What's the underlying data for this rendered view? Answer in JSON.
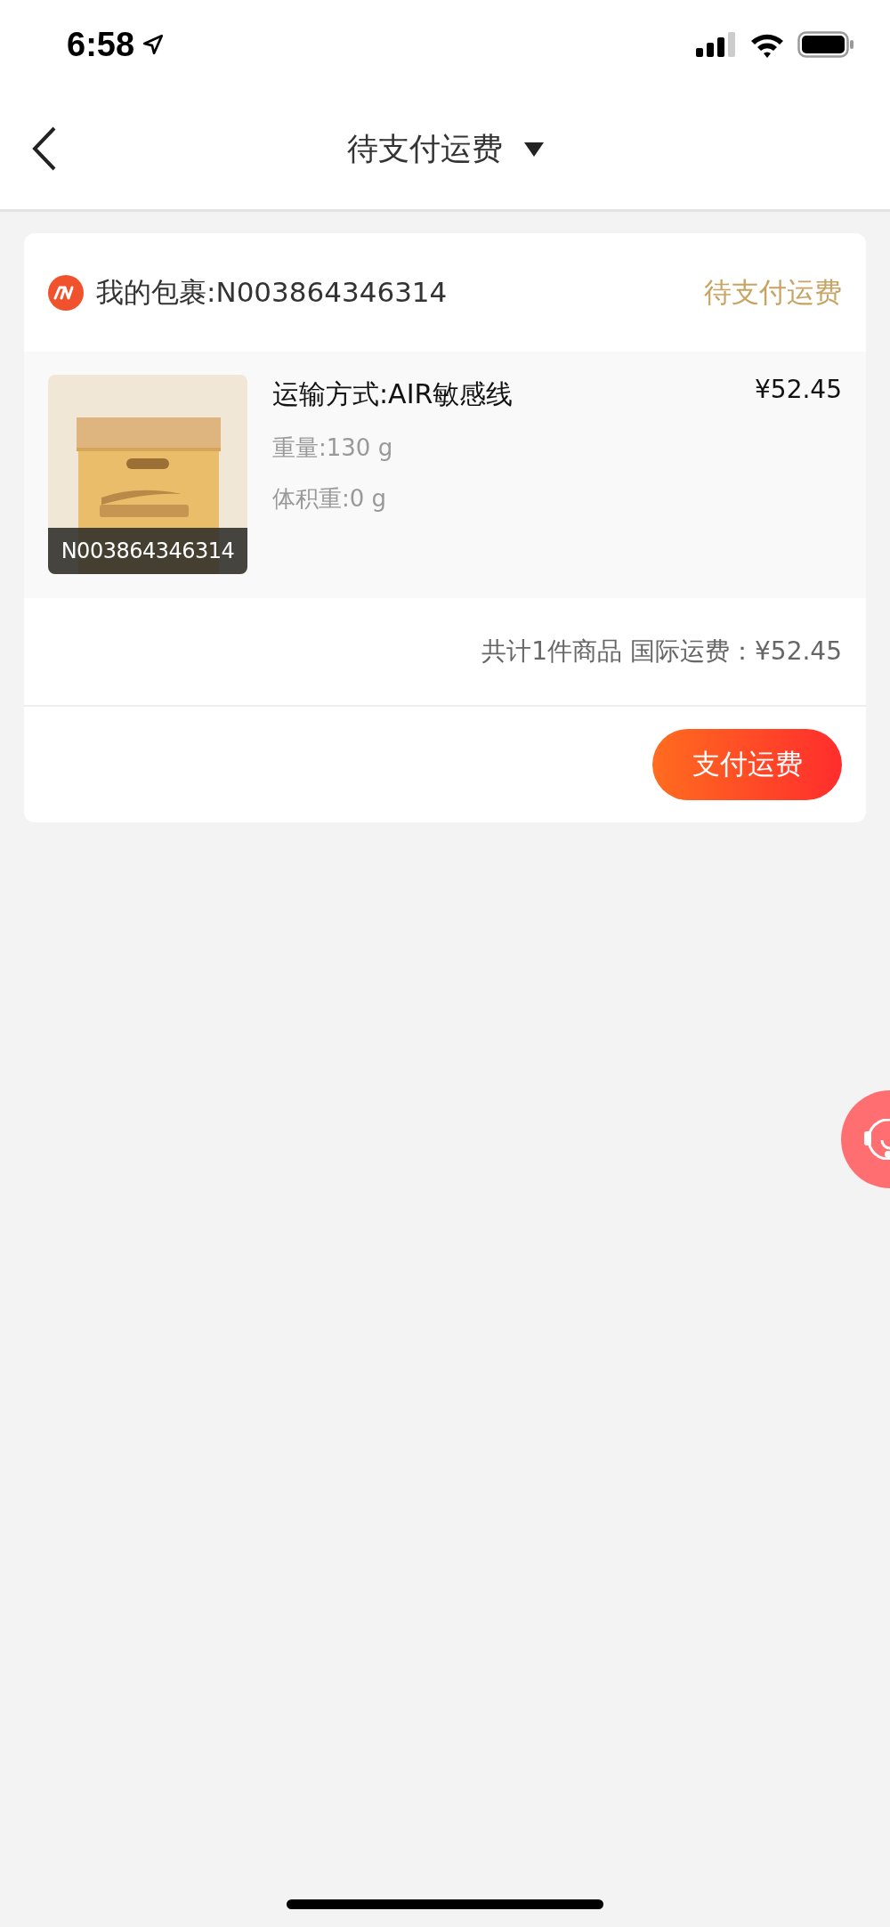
{
  "status_bar": {
    "time": "6:58"
  },
  "header": {
    "title": "待支付运费"
  },
  "package": {
    "label": "我的包裹:N003864346314",
    "status": "待支付运费",
    "item": {
      "kind": "picture",
      "caption": "N003864346314",
      "shipping": "运输方式:AIR敏感线",
      "price": "¥52.45",
      "weight": "重量:130 g",
      "volume_weight": "体积重:0 g"
    },
    "summary": "共计1件商品 国际运费：¥52.45",
    "pay_button": "支付运费"
  }
}
